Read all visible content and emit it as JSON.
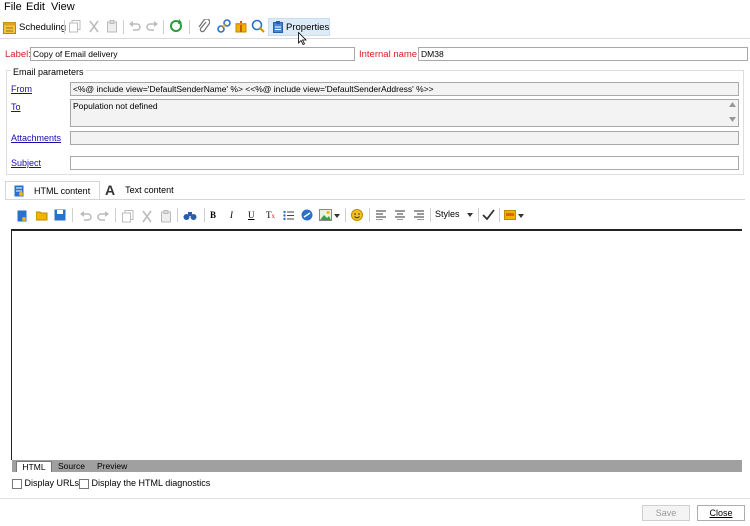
{
  "menu": {
    "file": "File",
    "edit": "Edit",
    "view": "View"
  },
  "toolbar": {
    "scheduling": "Scheduling",
    "properties": "Properties"
  },
  "form": {
    "label_caption": "Label:",
    "label_value": "Copy of Email delivery",
    "internal_caption": "Internal name:",
    "internal_value": "DM38"
  },
  "email_params": {
    "title": "Email parameters",
    "from_label": "From",
    "from_value": "<%@ include view='DefaultSenderName' %> <<%@ include view='DefaultSenderAddress' %>>",
    "to_label": "To",
    "to_value": "Population not defined",
    "attachments_label": "Attachments",
    "subject_label": "Subject"
  },
  "content_tabs": {
    "html": "HTML content",
    "text": "Text content"
  },
  "editor_toolbar": {
    "styles": "Styles"
  },
  "editor_tabs": {
    "html": "HTML",
    "source": "Source",
    "preview": "Preview"
  },
  "options": {
    "display_urls": "Display URLs",
    "display_diag": "Display the HTML diagnostics"
  },
  "buttons": {
    "save": "Save",
    "close": "Close"
  },
  "colors": {
    "accent_red": "#d42020",
    "link": "#1a0dab",
    "hover": "#dcebf7"
  }
}
